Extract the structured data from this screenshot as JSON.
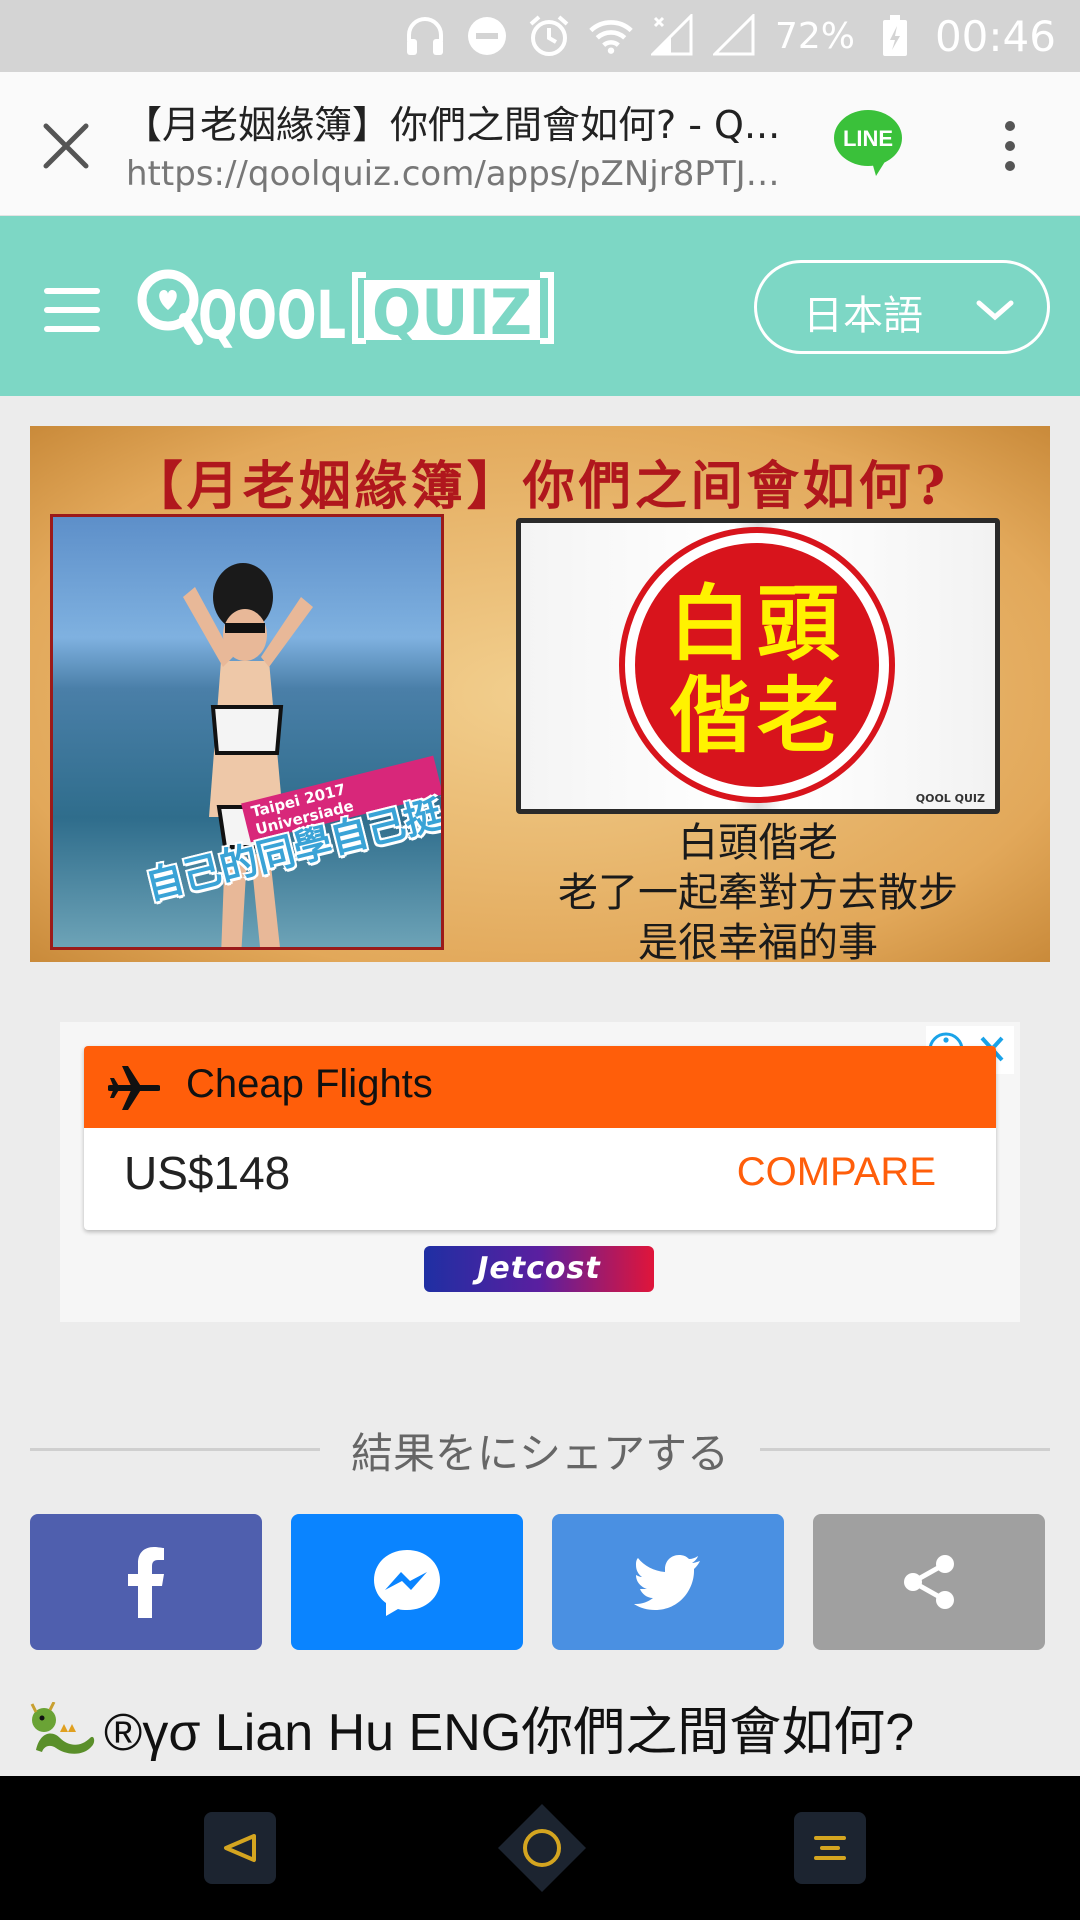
{
  "status_bar": {
    "battery": "72%",
    "time": "00:46",
    "icons": [
      "headphones-icon",
      "do-not-disturb-icon",
      "alarm-icon",
      "wifi-icon",
      "signal-icon",
      "signal-empty-icon",
      "battery-charging-icon"
    ]
  },
  "browser": {
    "title": "【月老姻緣簿】你們之間會如何? - Q...",
    "url": "https://qoolquiz.com/apps/pZNjr8PTJ1...",
    "line_label": "LINE"
  },
  "site": {
    "logo_text": "QOOL QUIZ",
    "language": "日本語"
  },
  "banner": {
    "title": "【月老姻緣簿】你們之间會如何?",
    "photo_caption_small": "Taipei 2017 Universiade",
    "photo_caption": "自己的同學自己挺!",
    "stamp_line1": "白頭",
    "stamp_line2": "偕老",
    "book_logo": "QOOL QUIZ",
    "desc_line1": "白頭偕老",
    "desc_line2": "老了一起牽對方去散步",
    "desc_line3": "是很幸福的事"
  },
  "ad": {
    "headline": "Cheap Flights",
    "price": "US$148",
    "cta": "COMPARE",
    "brand": "Jetcost"
  },
  "share": {
    "heading": "結果をにシェアする",
    "buttons": [
      {
        "name": "facebook",
        "color": "#4f5fae"
      },
      {
        "name": "messenger",
        "color": "#0a84ff"
      },
      {
        "name": "twitter",
        "color": "#4a90e2"
      },
      {
        "name": "share",
        "color": "#a0a0a0"
      }
    ]
  },
  "user_line": "®γσ Lian Hu ENG你們之間會如何?",
  "colors": {
    "header_teal": "#7dd7c5",
    "ad_orange": "#ff5e0a",
    "banner_red": "#b0171d"
  }
}
